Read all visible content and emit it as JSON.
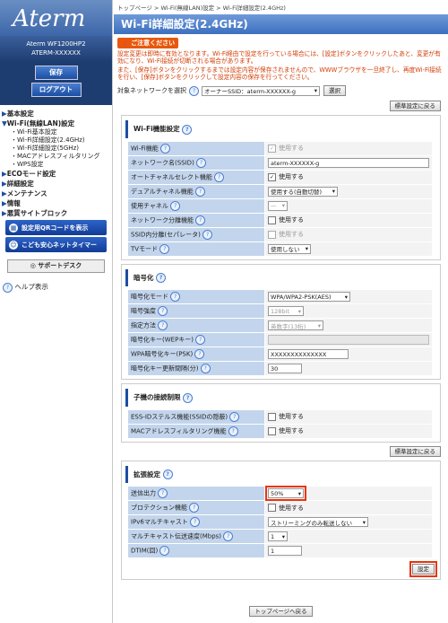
{
  "sidebar": {
    "logo": "Aterm",
    "model_line1": "Aterm WF1200HP2",
    "model_line2": "ATERM-XXXXXX",
    "save_label": "保存",
    "logout_label": "ログアウト",
    "nav": [
      {
        "label": "基本設定"
      },
      {
        "label": "Wi-Fi(無線LAN)設定",
        "sub": [
          "Wi-Fi基本設定",
          "Wi-Fi詳細設定(2.4GHz)",
          "Wi-Fi詳細設定(5GHz)",
          "MACアドレスフィルタリング",
          "WPS設定"
        ]
      },
      {
        "label": "ECOモード設定"
      },
      {
        "label": "詳細設定"
      },
      {
        "label": "メンテナンス"
      },
      {
        "label": "情報"
      },
      {
        "label": "悪質サイトブロック"
      }
    ],
    "qr_button": "設定用QRコードを表示",
    "timer_button": "こども安心ネットタイマー",
    "support_button": "サポートデスク",
    "help": "ヘルプ表示"
  },
  "breadcrumb": "トップページ > Wi-Fi(無線LAN)設定 > Wi-Fi詳細設定(2.4GHz)",
  "title": "Wi-Fi詳細設定(2.4GHz)",
  "caution": {
    "title": "ご注意ください",
    "line1": "設定変更は即時に有効となります。Wi-Fi経由で設定を行っている場合には、[設定]ボタンをクリックしたあと、変更が有効になり、Wi-Fi接続が切断される場合があります。",
    "line2": "また、[保存]ボタンをクリックするまでは設定内容が保存されませんので、WWWブラウザを一旦終了し、再度Wi-Fi接続を行い、[保存]ボタンをクリックして設定内容の保存を行ってください。"
  },
  "target": {
    "label": "対象ネットワークを選択",
    "value": "オーナーSSID：aterm-XXXXXX-g",
    "select_button": "選択"
  },
  "default_button": "標準設定に戻る",
  "sections": {
    "wifi": {
      "title": "Wi-Fi機能設定",
      "rows": {
        "wifi_func": {
          "label": "Wi-Fi機能",
          "value": "使用する"
        },
        "ssid": {
          "label": "ネットワーク名(SSID)",
          "value": "aterm-XXXXXX-g"
        },
        "auto_channel": {
          "label": "オートチャネルセレクト機能",
          "value": "使用する"
        },
        "dual_channel": {
          "label": "デュアルチャネル機能",
          "value": "使用する(自動切替)"
        },
        "channel": {
          "label": "使用チャネル",
          "value": "—"
        },
        "net_sep": {
          "label": "ネットワーク分離機能",
          "value": "使用する"
        },
        "ssid_sep": {
          "label": "SSID内分離(セパレータ)",
          "value": "使用する"
        },
        "tv_mode": {
          "label": "TVモード",
          "value": "使用しない"
        }
      }
    },
    "enc": {
      "title": "暗号化",
      "rows": {
        "mode": {
          "label": "暗号化モード",
          "value": "WPA/WPA2-PSK(AES)"
        },
        "strength": {
          "label": "暗号強度",
          "value": "128bit"
        },
        "method": {
          "label": "指定方法",
          "value": "英数字(13桁)"
        },
        "wep": {
          "label": "暗号化キー(WEPキー)",
          "value": ""
        },
        "psk": {
          "label": "WPA暗号化キー(PSK)",
          "value": "XXXXXXXXXXXXXX"
        },
        "interval": {
          "label": "暗号化キー更新間隔(分)",
          "value": "30"
        }
      }
    },
    "restrict": {
      "title": "子機の接続制限",
      "rows": {
        "stealth": {
          "label": "ESS-IDステルス機能(SSIDの隠蔽)",
          "value": "使用する"
        },
        "mac": {
          "label": "MACアドレスフィルタリング機能",
          "value": "使用する"
        }
      }
    },
    "ext": {
      "title": "拡張設定",
      "rows": {
        "power": {
          "label": "送信出力",
          "value": "50%"
        },
        "protect": {
          "label": "プロテクション機能",
          "value": "使用する"
        },
        "ipv6": {
          "label": "IPv6マルチキャスト",
          "value": "ストリーミングのみ転送しない"
        },
        "mcast": {
          "label": "マルチキャスト伝送速度(Mbps)",
          "value": "1"
        },
        "dtim": {
          "label": "DTIM(回)",
          "value": "1"
        }
      }
    }
  },
  "set_button": "設定",
  "top_button": "トップページへ戻る"
}
